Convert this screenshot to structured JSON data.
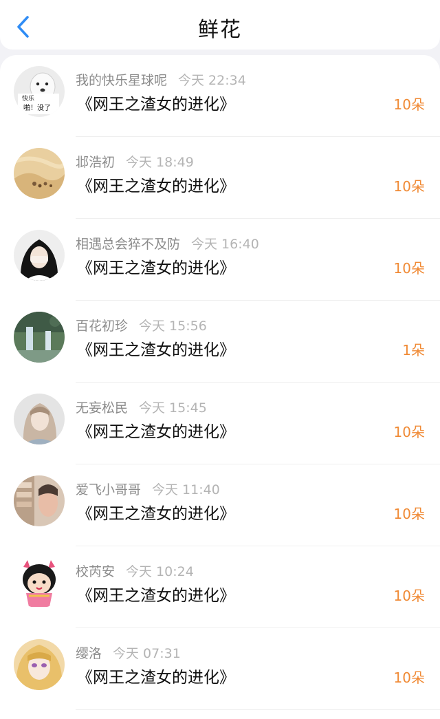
{
  "header": {
    "title": "鲜花",
    "back_icon": "chevron-left-icon",
    "accent_color": "#2f8cf5"
  },
  "gifts": [
    {
      "user": "我的快乐星球呢",
      "time": "今天 22:34",
      "book": "《网王之渣女的进化》",
      "count": "10朵",
      "avatar_label_1": "快乐",
      "avatar_label_2": "啪！没了"
    },
    {
      "user": "邶浩初",
      "time": "今天 18:49",
      "book": "《网王之渣女的进化》",
      "count": "10朵"
    },
    {
      "user": "相遇总会猝不及防",
      "time": "今天 16:40",
      "book": "《网王之渣女的进化》",
      "count": "10朵"
    },
    {
      "user": "百花初珍",
      "time": "今天 15:56",
      "book": "《网王之渣女的进化》",
      "count": "1朵"
    },
    {
      "user": "无妄松民",
      "time": "今天 15:45",
      "book": "《网王之渣女的进化》",
      "count": "10朵"
    },
    {
      "user": "爱飞小哥哥",
      "time": "今天 11:40",
      "book": "《网王之渣女的进化》",
      "count": "10朵"
    },
    {
      "user": "校芮安",
      "time": "今天 10:24",
      "book": "《网王之渣女的进化》",
      "count": "10朵"
    },
    {
      "user": "缨洛",
      "time": "今天 07:31",
      "book": "《网王之渣女的进化》",
      "count": "10朵"
    }
  ],
  "colors": {
    "count": "#f08a35",
    "username": "#8c8c8c",
    "time": "#b4b4b4"
  }
}
